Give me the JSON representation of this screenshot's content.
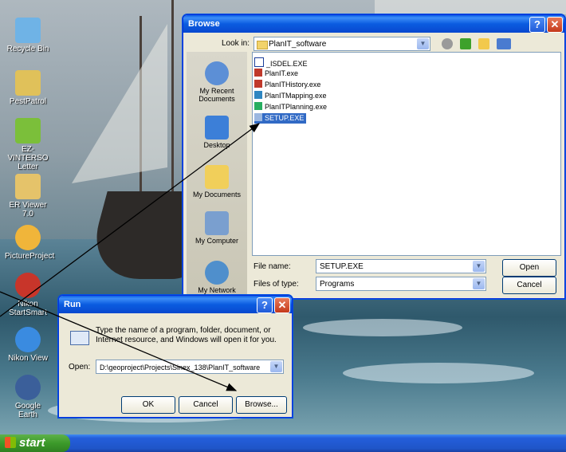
{
  "desktop": {
    "icons": [
      {
        "label": "Recycle Bin",
        "icon": "recycle-bin-icon",
        "color": "#6fb3e6"
      },
      {
        "label": "PestPatrol",
        "icon": "pestpatrol-icon",
        "color": "#e0c15a"
      },
      {
        "label": "EZ-VINTERSO Letter",
        "icon": "letter-app-icon",
        "color": "#7bbf3a"
      },
      {
        "label": "ER Viewer 7.0",
        "icon": "er-viewer-icon",
        "color": "#e5c36a"
      },
      {
        "label": "PictureProject",
        "icon": "pictureproject-icon",
        "color": "#f0b53a"
      },
      {
        "label": "Nikon StartSmart",
        "icon": "nikon-startsmart-icon",
        "color": "#c8352a"
      },
      {
        "label": "Nikon View",
        "icon": "nikon-view-icon",
        "color": "#3a8be0"
      },
      {
        "label": "Google Earth",
        "icon": "google-earth-icon",
        "color": "#3b5f9a"
      }
    ]
  },
  "taskbar": {
    "start_label": "start"
  },
  "browse": {
    "title": "Browse",
    "look_in_label": "Look in:",
    "look_in_value": "PlanIT_software",
    "places": [
      {
        "label": "My Recent Documents",
        "icon": "recent-documents-icon"
      },
      {
        "label": "Desktop",
        "icon": "desktop-icon"
      },
      {
        "label": "My Documents",
        "icon": "my-documents-icon"
      },
      {
        "label": "My Computer",
        "icon": "my-computer-icon"
      },
      {
        "label": "My Network",
        "icon": "my-network-icon"
      }
    ],
    "files": [
      "_ISDEL.EXE",
      "PlanIT.exe",
      "PlanITHistory.exe",
      "PlanITMapping.exe",
      "PlanITPlanning.exe",
      "SETUP.EXE"
    ],
    "selected_file": "SETUP.EXE",
    "file_name_label": "File name:",
    "file_name_value": "SETUP.EXE",
    "files_of_type_label": "Files of type:",
    "files_of_type_value": "Programs",
    "open_label": "Open",
    "cancel_label": "Cancel"
  },
  "run": {
    "title": "Run",
    "description": "Type the name of a program, folder, document, or Internet resource, and Windows will open it for you.",
    "open_label": "Open:",
    "open_value": "D:\\geoproject\\Projects\\Sinex_138\\PlanIT_software",
    "ok_label": "OK",
    "cancel_label": "Cancel",
    "browse_label": "Browse..."
  },
  "colors": {
    "xp_blue": "#0054e3",
    "selection": "#316ac5",
    "start_green": "#3c9a2a"
  }
}
